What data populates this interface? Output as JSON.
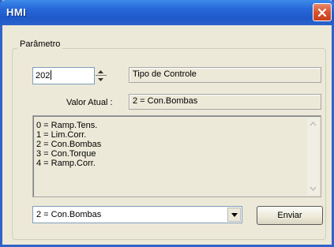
{
  "window": {
    "title": "HMI"
  },
  "group": {
    "label": "Parâmetro"
  },
  "parameter": {
    "number_value": "202",
    "name": "Tipo de Controle",
    "current_value_label": "Valor Atual :",
    "current_value": "2 = Con.Bombas"
  },
  "options_list": {
    "items": [
      "0 = Ramp.Tens.",
      "1 = Lim.Corr.",
      "2 = Con.Bombas",
      "3 = Con.Torque",
      "4 = Ramp.Corr."
    ]
  },
  "selector": {
    "selected": "2 = Con.Bombas"
  },
  "actions": {
    "send_label": "Enviar"
  },
  "colors": {
    "titlebar": "#2768d8",
    "close_button": "#d8542f",
    "window_bg": "#ece9d8"
  }
}
